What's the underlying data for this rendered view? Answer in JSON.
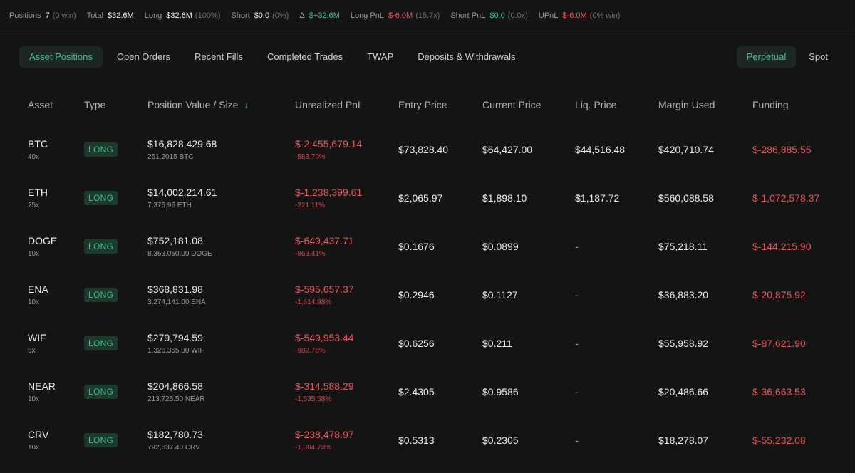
{
  "summary": {
    "positions_label": "Positions",
    "positions_value": "7",
    "positions_note": "(0 win)",
    "total_label": "Total",
    "total_value": "$32.6M",
    "long_label": "Long",
    "long_value": "$32.6M",
    "long_note": "(100%)",
    "short_label": "Short",
    "short_value": "$0.0",
    "short_note": "(0%)",
    "delta_label": "Δ",
    "delta_value": "$+32.6M",
    "longpnl_label": "Long PnL",
    "longpnl_value": "$-6.0M",
    "longpnl_note": "(15.7x)",
    "shortpnl_label": "Short PnL",
    "shortpnl_value": "$0.0",
    "shortpnl_note": "(0.0x)",
    "upnl_label": "UPnL",
    "upnl_value": "$-6.0M",
    "upnl_note": "(0% win)"
  },
  "tabs": [
    "Asset Positions",
    "Open Orders",
    "Recent Fills",
    "Completed Trades",
    "TWAP",
    "Deposits & Withdrawals"
  ],
  "market_tabs": [
    "Perpetual",
    "Spot"
  ],
  "table": {
    "headers": [
      "Asset",
      "Type",
      "Position Value / Size",
      "Unrealized PnL",
      "Entry Price",
      "Current Price",
      "Liq. Price",
      "Margin Used",
      "Funding"
    ],
    "rows": [
      {
        "asset": "BTC",
        "leverage": "40x",
        "type": "LONG",
        "value": "$16,828,429.68",
        "size": "261.2015 BTC",
        "pnl": "$-2,455,679.14",
        "pnl_pct": "-583.70%",
        "entry": "$73,828.40",
        "current": "$64,427.00",
        "liq": "$44,516.48",
        "margin": "$420,710.74",
        "funding": "$-286,885.55"
      },
      {
        "asset": "ETH",
        "leverage": "25x",
        "type": "LONG",
        "value": "$14,002,214.61",
        "size": "7,376.96 ETH",
        "pnl": "$-1,238,399.61",
        "pnl_pct": "-221.11%",
        "entry": "$2,065.97",
        "current": "$1,898.10",
        "liq": "$1,187.72",
        "margin": "$560,088.58",
        "funding": "$-1,072,578.37"
      },
      {
        "asset": "DOGE",
        "leverage": "10x",
        "type": "LONG",
        "value": "$752,181.08",
        "size": "8,363,050.00 DOGE",
        "pnl": "$-649,437.71",
        "pnl_pct": "-863.41%",
        "entry": "$0.1676",
        "current": "$0.0899",
        "liq": "-",
        "margin": "$75,218.11",
        "funding": "$-144,215.90"
      },
      {
        "asset": "ENA",
        "leverage": "10x",
        "type": "LONG",
        "value": "$368,831.98",
        "size": "3,274,141.00 ENA",
        "pnl": "$-595,657.37",
        "pnl_pct": "-1,614.98%",
        "entry": "$0.2946",
        "current": "$0.1127",
        "liq": "-",
        "margin": "$36,883.20",
        "funding": "$-20,875.92"
      },
      {
        "asset": "WIF",
        "leverage": "5x",
        "type": "LONG",
        "value": "$279,794.59",
        "size": "1,326,355.00 WIF",
        "pnl": "$-549,953.44",
        "pnl_pct": "-982.78%",
        "entry": "$0.6256",
        "current": "$0.211",
        "liq": "-",
        "margin": "$55,958.92",
        "funding": "$-87,621.90"
      },
      {
        "asset": "NEAR",
        "leverage": "10x",
        "type": "LONG",
        "value": "$204,866.58",
        "size": "213,725.50 NEAR",
        "pnl": "$-314,588.29",
        "pnl_pct": "-1,535.58%",
        "entry": "$2.4305",
        "current": "$0.9586",
        "liq": "-",
        "margin": "$20,486.66",
        "funding": "$-36,663.53"
      },
      {
        "asset": "CRV",
        "leverage": "10x",
        "type": "LONG",
        "value": "$182,780.73",
        "size": "792,837.40 CRV",
        "pnl": "$-238,478.97",
        "pnl_pct": "-1,304.73%",
        "entry": "$0.5313",
        "current": "$0.2305",
        "liq": "-",
        "margin": "$18,278.07",
        "funding": "$-55,232.08"
      }
    ]
  },
  "colors": {
    "accent": "#3ec28f",
    "negative": "#e5585c",
    "background": "#141414"
  }
}
